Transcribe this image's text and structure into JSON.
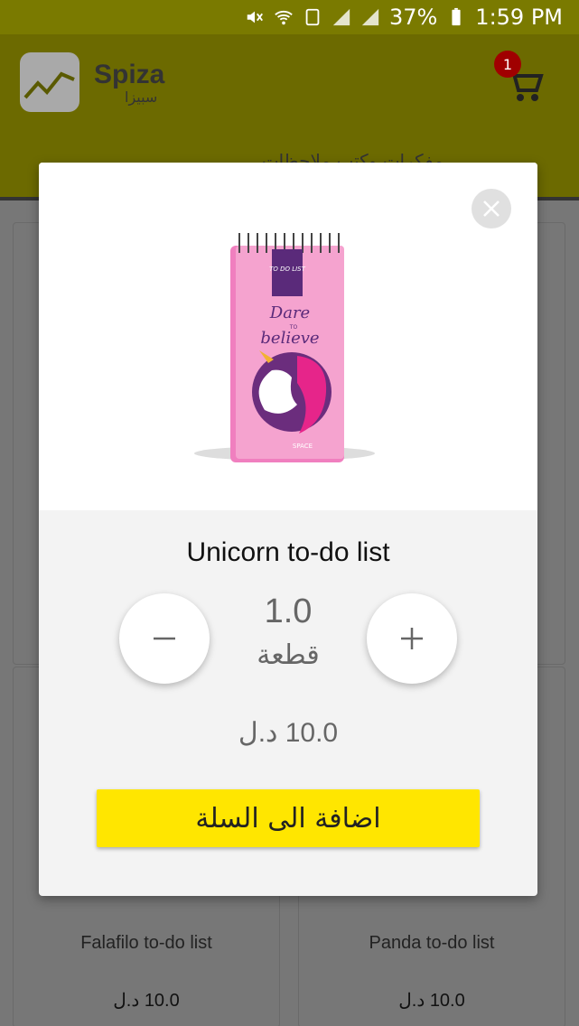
{
  "status_bar": {
    "battery": "37%",
    "time": "1:59 PM",
    "icons": [
      "mute-icon",
      "wifi-icon",
      "sim-icon",
      "signal-icon",
      "signal-icon",
      "battery-icon"
    ]
  },
  "app_bar": {
    "logo_text": "Spiza",
    "logo_sub": "سبيزا",
    "cart_count": "1",
    "tab_label": "مفكرات وكتب ملاحظات",
    "color": "#6c6a00"
  },
  "grid": {
    "cards": [
      {
        "name": "Falafilo to-do list",
        "price": "10.0 د.ل"
      },
      {
        "name": "Panda to-do list",
        "price": "10.0 د.ل"
      }
    ]
  },
  "modal": {
    "notebook": {
      "label": "TO DO LIST",
      "tagline_1": "Dare",
      "tagline_2": "TO",
      "tagline_3": "believe",
      "brand": "SPACE"
    },
    "product_title": "Unicorn to-do list",
    "quantity": "1.0",
    "unit": "قطعة",
    "price": "10.0 د.ل",
    "add_to_cart_label": "اضافة الى السلة",
    "accent_color": "#ffe600"
  }
}
